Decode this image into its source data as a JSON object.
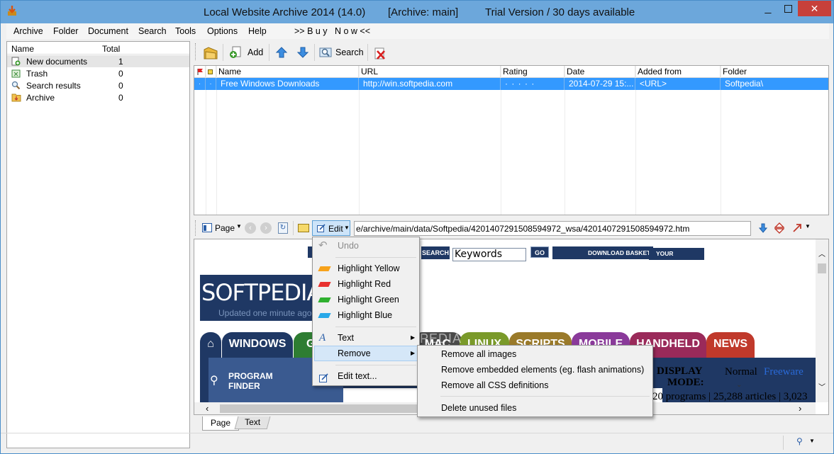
{
  "window": {
    "title_app": "Local Website Archive 2014 (14.0)",
    "title_archive": "[Archive: main]",
    "title_trial": "Trial Version / 30 days available",
    "close_glyph": "✕"
  },
  "menubar": {
    "items": [
      "Archive",
      "Folder",
      "Document",
      "Search",
      "Tools",
      "Options",
      "Help"
    ],
    "buy_now": ">> B u y   N o w <<"
  },
  "sidebar": {
    "col_name": "Name",
    "col_total": "Total",
    "items": [
      {
        "label": "New documents",
        "total": "1"
      },
      {
        "label": "Trash",
        "total": "0"
      },
      {
        "label": "Search results",
        "total": "0"
      },
      {
        "label": "Archive",
        "total": "0"
      }
    ]
  },
  "toolbar": {
    "add_label": "Add",
    "search_label": "Search"
  },
  "doc_list": {
    "headers": [
      "Name",
      "URL",
      "Rating",
      "Date",
      "Added from",
      "Folder"
    ],
    "rows": [
      {
        "name": "Free Windows Downloads",
        "url": "http://win.softpedia.com",
        "rating": "· · · · ·",
        "date": "2014-07-29 15:...",
        "added_from": "<URL>",
        "folder": "Softpedia\\"
      }
    ]
  },
  "viewer_toolbar": {
    "page_label": "Page",
    "edit_label": "Edit",
    "path": "e/archive/main/data/Softpedia/42014072915085949​72_wsa/4201407291508594972.htm"
  },
  "webpage": {
    "search_btn": "SEARCH",
    "search_value": "Keywords",
    "go_btn": "GO",
    "download_basket": "DOWNLOAD BASKET",
    "your_account": "YOUR ACCOUNT",
    "logo": "SOFTPEDIA",
    "updated": "Updated one minute ago",
    "tabs": [
      "WINDOWS",
      "GA",
      "MAC",
      "LINUX",
      "SCRIPTS",
      "MOBILE",
      "HANDHELD",
      "NEWS"
    ],
    "program_finder_1": "PROGRAM",
    "program_finder_2": "FINDER",
    "display_mode_1": "DISPLAY",
    "display_mode_2": "MODE:",
    "normal": "Normal",
    "freeware": "Freeware",
    "stats": "20 programs | 25,288 articles | 3,023",
    "watermark": "SOFTPEDIA"
  },
  "edit_menu": {
    "items": [
      "Undo",
      "Highlight Yellow",
      "Highlight Red",
      "Highlight Green",
      "Highlight Blue",
      "Text",
      "Remove",
      "Edit text..."
    ],
    "swatch_colors": [
      "#f7a21b",
      "#e8302e",
      "#2fb02f",
      "#28a8e8"
    ]
  },
  "remove_submenu": {
    "items": [
      "Remove all images",
      "Remove embedded elements (eg. flash animations)",
      "Remove all CSS definitions",
      "Delete unused files"
    ]
  },
  "bottom_tabs": [
    "Page",
    "Text"
  ],
  "colors": {
    "titlebar": "#6ca7db",
    "selection": "#3399ff",
    "softpedia_navy": "#1f3864"
  }
}
